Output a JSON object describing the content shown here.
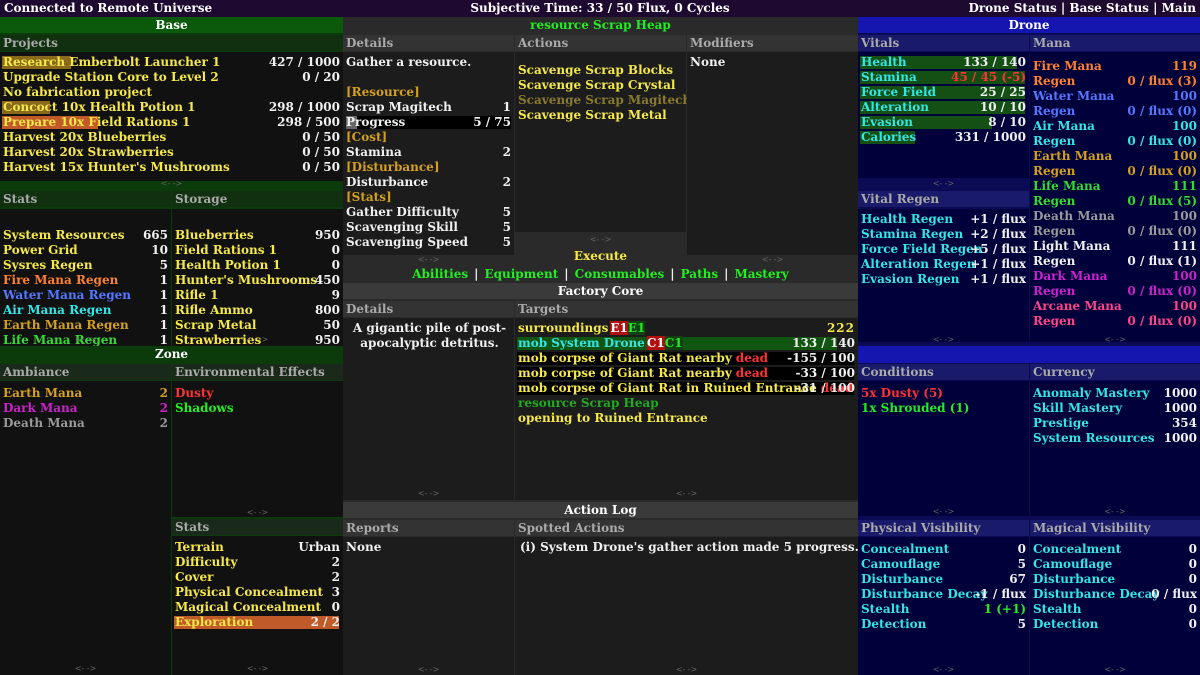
{
  "topbar": {
    "left": "Connected to Remote Universe",
    "center": "Subjective Time: 33 / 50 Flux,  0 Cycles",
    "right": "Drone Status  |  Base Status  |  Main"
  },
  "base": {
    "title": "Base",
    "projects_label": "Projects",
    "projects": [
      {
        "name": "Research Emberbolt Launcher 1",
        "value": "427 / 1000",
        "progress": 0.427
      },
      {
        "name": "Upgrade Station Core to Level 2",
        "value": "0 / 20",
        "progress": 0
      },
      {
        "name": "No fabrication project",
        "value": "",
        "progress": 0
      },
      {
        "name": "Concoct 10x Health Potion 1",
        "value": "298 / 1000",
        "progress": 0.298
      },
      {
        "name": "Prepare 10x Field Rations 1",
        "value": "298 / 500",
        "progress": 0.596
      },
      {
        "name": "Harvest 20x Blueberries",
        "value": "0 / 50",
        "progress": 0
      },
      {
        "name": "Harvest 20x Strawberries",
        "value": "0 / 50",
        "progress": 0
      },
      {
        "name": "Harvest 15x Hunter's Mushrooms",
        "value": "0 / 50",
        "progress": 0
      }
    ],
    "stats_label": "Stats",
    "stats": [
      {
        "name": "System Resources",
        "value": "665",
        "color": "#f5e84a"
      },
      {
        "name": "Power Grid",
        "value": "10",
        "color": "#f5e84a"
      },
      {
        "name": "Sysres Regen",
        "value": "5",
        "color": "#f5e84a"
      },
      {
        "name": "Fire Mana Regen",
        "value": "1",
        "color": "#ff8030"
      },
      {
        "name": "Water Mana Regen",
        "value": "1",
        "color": "#5577ff"
      },
      {
        "name": "Air Mana Regen",
        "value": "1",
        "color": "#33e6e6"
      },
      {
        "name": "Earth Mana Regen",
        "value": "1",
        "color": "#d4a020"
      },
      {
        "name": "Life Mana Regen",
        "value": "1",
        "color": "#33dd33"
      }
    ],
    "storage_label": "Storage",
    "storage": [
      {
        "name": "Blueberries",
        "value": "950"
      },
      {
        "name": "Field Rations 1",
        "value": "0"
      },
      {
        "name": "Health Potion 1",
        "value": "0"
      },
      {
        "name": "Hunter's Mushrooms",
        "value": "450"
      },
      {
        "name": "Rifle 1",
        "value": "9"
      },
      {
        "name": "Rifle Ammo",
        "value": "800"
      },
      {
        "name": "Scrap Metal",
        "value": "50"
      },
      {
        "name": "Strawberries",
        "value": "950"
      }
    ]
  },
  "zone": {
    "title": "Zone",
    "ambiance_label": "Ambiance",
    "ambiance": [
      {
        "name": "Earth Mana",
        "value": "2",
        "color": "#d4a020"
      },
      {
        "name": "Dark Mana",
        "value": "2",
        "color": "#cc22cc"
      },
      {
        "name": "Death Mana",
        "value": "2",
        "color": "#9a9a9a"
      }
    ],
    "env_label": "Environmental Effects",
    "env": [
      {
        "name": "Dusty",
        "color": "#ff3333"
      },
      {
        "name": "Shadows",
        "color": "#22ee22"
      }
    ],
    "stats_label": "Stats",
    "stats": [
      {
        "name": "Terrain",
        "value": "Urban"
      },
      {
        "name": "Difficulty",
        "value": "2"
      },
      {
        "name": "Cover",
        "value": "2"
      },
      {
        "name": "Physical Concealment",
        "value": "3"
      },
      {
        "name": "Magical Concealment",
        "value": "0"
      },
      {
        "name": "Exploration",
        "value": "2 / 2",
        "progress": 1
      }
    ]
  },
  "center": {
    "title": "resource Scrap Heap",
    "details_label": "Details",
    "details": [
      {
        "name": "Gather a resource.",
        "value": "",
        "color": "#f0f0f0"
      },
      {
        "name": "",
        "value": ""
      },
      {
        "name": "[Resource]",
        "value": "",
        "color": "#d4a020"
      },
      {
        "name": "Scrap Magitech",
        "value": "1",
        "color": "#f0f0f0"
      },
      {
        "name": "Progress",
        "value": "5 / 75",
        "color": "#f0f0f0"
      },
      {
        "name": "[Cost]",
        "value": "",
        "color": "#d4a020"
      },
      {
        "name": "Stamina",
        "value": "2",
        "color": "#f0f0f0"
      },
      {
        "name": "[Disturbance]",
        "value": "",
        "color": "#d4a020"
      },
      {
        "name": "Disturbance",
        "value": "2",
        "color": "#f0f0f0"
      },
      {
        "name": "[Stats]",
        "value": "",
        "color": "#d4a020"
      },
      {
        "name": "Gather Difficulty",
        "value": "5",
        "color": "#f0f0f0"
      },
      {
        "name": "Scavenging Skill",
        "value": "5",
        "color": "#f0f0f0"
      },
      {
        "name": "Scavenging Speed",
        "value": "5",
        "color": "#f0f0f0"
      }
    ],
    "actions_label": "Actions",
    "actions": [
      {
        "name": "Scavenge Scrap Blocks",
        "color": "#f5e84a"
      },
      {
        "name": "Scavenge Scrap Crystal",
        "color": "#f5e84a"
      },
      {
        "name": "Scavenge Scrap Magitech",
        "color": "#8a7a30"
      },
      {
        "name": "Scavenge Scrap Metal",
        "color": "#f5e84a"
      }
    ],
    "modifiers_label": "Modifiers",
    "modifiers_value": "None",
    "execute_label": "Execute",
    "tabs": [
      "Abilities",
      "Equipment",
      "Consumables",
      "Paths",
      "Mastery"
    ],
    "tab_sep": "|",
    "factory_title": "Factory Core",
    "f_details_label": "Details",
    "f_details_text": "A gigantic pile of post-apocalyptic detritus.",
    "targets_label": "Targets",
    "targets": [
      {
        "name": "surroundings",
        "tag1": "E1",
        "tag2": "E1",
        "value": "",
        "marks": "222",
        "color": "#f5e84a"
      },
      {
        "name": "mob System Drone",
        "tag1": "C1",
        "tag2": "C1",
        "value": "133 / 140",
        "color": "#33e6e6",
        "progress": 0.95
      },
      {
        "name": "mob corpse of Giant Rat nearby",
        "dead": "dead",
        "value": "-155 / 100",
        "color": "#f5e84a"
      },
      {
        "name": "mob corpse of Giant Rat nearby",
        "dead": "dead",
        "value": "-33 / 100",
        "color": "#f5e84a"
      },
      {
        "name": "mob corpse of Giant Rat in Ruined Entrance",
        "dead": "dead",
        "value": "-31 / 100",
        "color": "#f5e84a"
      },
      {
        "name": "resource Scrap Heap",
        "value": "",
        "color": "#22aa22"
      },
      {
        "name": "opening to Ruined Entrance",
        "value": "",
        "color": "#f5e84a"
      }
    ],
    "log_title": "Action Log",
    "reports_label": "Reports",
    "reports_value": "None",
    "spotted_label": "Spotted Actions",
    "spotted_text": "(i) System Drone's gather action made 5 progress."
  },
  "drone": {
    "title": "Drone",
    "vitals_label": "Vitals",
    "vitals": [
      {
        "name": "Health",
        "value": "133 / 140",
        "progress": 0.95,
        "color": "#33e6e6",
        "vcolor": "#f0f0f0"
      },
      {
        "name": "Stamina",
        "value": "45 / 45 (-5)",
        "progress": 1,
        "color": "#33e6e6",
        "vcolor": "#ff3333"
      },
      {
        "name": "Force Field",
        "value": "25 / 25",
        "progress": 1,
        "color": "#33e6e6",
        "vcolor": "#f0f0f0"
      },
      {
        "name": "Alteration",
        "value": "10 / 10",
        "progress": 1,
        "color": "#33e6e6",
        "vcolor": "#f0f0f0"
      },
      {
        "name": "Evasion",
        "value": "8 / 10",
        "progress": 0.8,
        "color": "#33e6e6",
        "vcolor": "#f0f0f0"
      },
      {
        "name": "Calories",
        "value": "331 / 1000",
        "progress": 0.331,
        "color": "#33e6e6",
        "vcolor": "#f0f0f0"
      }
    ],
    "mana_label": "Mana",
    "mana": [
      {
        "name": "Fire Mana",
        "value": "119",
        "color": "#ff8030"
      },
      {
        "name": "Regen",
        "value": "0 / flux (3)",
        "color": "#ff8030"
      },
      {
        "name": "Water Mana",
        "value": "100",
        "color": "#5577ff"
      },
      {
        "name": "Regen",
        "value": "0 / flux (0)",
        "color": "#5577ff"
      },
      {
        "name": "Air Mana",
        "value": "100",
        "color": "#33e6e6"
      },
      {
        "name": "Regen",
        "value": "0 / flux (0)",
        "color": "#33e6e6"
      },
      {
        "name": "Earth Mana",
        "value": "100",
        "color": "#d4a020"
      },
      {
        "name": "Regen",
        "value": "0 / flux (0)",
        "color": "#d4a020"
      },
      {
        "name": "Life Mana",
        "value": "111",
        "color": "#33dd33"
      },
      {
        "name": "Regen",
        "value": "0 / flux (5)",
        "color": "#33dd33"
      },
      {
        "name": "Death Mana",
        "value": "100",
        "color": "#9a9a9a"
      },
      {
        "name": "Regen",
        "value": "0 / flux (0)",
        "color": "#9a9a9a"
      },
      {
        "name": "Light Mana",
        "value": "111",
        "color": "#f0f0f0"
      },
      {
        "name": "Regen",
        "value": "0 / flux (1)",
        "color": "#f0f0f0"
      },
      {
        "name": "Dark Mana",
        "value": "100",
        "color": "#cc22cc"
      },
      {
        "name": "Regen",
        "value": "0 / flux (0)",
        "color": "#cc22cc"
      },
      {
        "name": "Arcane Mana",
        "value": "100",
        "color": "#ff4488"
      },
      {
        "name": "Regen",
        "value": "0 / flux (0)",
        "color": "#ff4488"
      }
    ],
    "vital_regen_label": "Vital Regen",
    "vital_regen": [
      {
        "name": "Health Regen",
        "value": "+1 / flux"
      },
      {
        "name": "Stamina Regen",
        "value": "+2 / flux"
      },
      {
        "name": "Force Field Regen",
        "value": "+5 / flux"
      },
      {
        "name": "Alteration Regen",
        "value": "+1 / flux"
      },
      {
        "name": "Evasion Regen",
        "value": "+1 / flux"
      }
    ],
    "conditions_label": "Conditions",
    "conditions": [
      {
        "name": "5x Dusty (5)",
        "color": "#ff3333"
      },
      {
        "name": "1x Shrouded (1)",
        "color": "#22ee22"
      }
    ],
    "currency_label": "Currency",
    "currency": [
      {
        "name": "Anomaly Mastery",
        "value": "1000"
      },
      {
        "name": "Skill Mastery",
        "value": "1000"
      },
      {
        "name": "Prestige",
        "value": "354"
      },
      {
        "name": "System Resources",
        "value": "1000"
      }
    ],
    "phys_label": "Physical Visibility",
    "phys": [
      {
        "name": "Concealment",
        "value": "0",
        "vcolor": "#f0f0f0"
      },
      {
        "name": "Camouflage",
        "value": "5",
        "vcolor": "#f0f0f0"
      },
      {
        "name": "Disturbance",
        "value": "67",
        "vcolor": "#f0f0f0"
      },
      {
        "name": "Disturbance Decay",
        "value": "-1 / flux",
        "vcolor": "#f0f0f0"
      },
      {
        "name": "Stealth",
        "value": "1 (+1)",
        "vcolor": "#22ee22"
      },
      {
        "name": "Detection",
        "value": "5",
        "vcolor": "#f0f0f0"
      }
    ],
    "mag_label": "Magical Visibility",
    "mag": [
      {
        "name": "Concealment",
        "value": "0"
      },
      {
        "name": "Camouflage",
        "value": "0"
      },
      {
        "name": "Disturbance",
        "value": "0"
      },
      {
        "name": "Disturbance Decay",
        "value": "0 / flux"
      },
      {
        "name": "Stealth",
        "value": "0"
      },
      {
        "name": "Detection",
        "value": "0"
      }
    ]
  },
  "nav": {
    "arrows": "<-   ->"
  }
}
